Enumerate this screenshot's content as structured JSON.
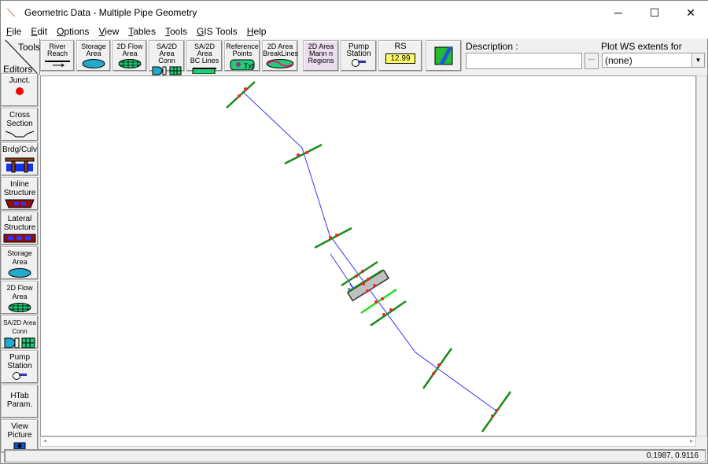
{
  "window": {
    "title": "Geometric Data - Multiple Pipe Geometry",
    "minimize": "─",
    "maximize": "☐",
    "close": "✕"
  },
  "menu": [
    "File",
    "Edit",
    "Options",
    "View",
    "Tables",
    "Tools",
    "GIS Tools",
    "Help"
  ],
  "tabs": {
    "tools": "Tools",
    "editors": "Editors"
  },
  "toolbar": [
    {
      "l1": "River",
      "l2": "Reach"
    },
    {
      "l1": "Storage",
      "l2": "Area"
    },
    {
      "l1": "2D Flow",
      "l2": "Area"
    },
    {
      "l1": "SA/2D Area",
      "l2": "Conn"
    },
    {
      "l1": "SA/2D Area",
      "l2": "BC Lines"
    },
    {
      "l1": "Reference",
      "l2": "Points"
    },
    {
      "l1": "2D Area",
      "l2": "BreakLines"
    },
    {
      "l1": "2D Area",
      "l2": "Mann n",
      "l3": "Regions"
    },
    {
      "l1": "Pump",
      "l2": "Station"
    },
    {
      "l1": "RS",
      "l2": "12.99"
    }
  ],
  "description": {
    "label": "Description :",
    "value": "",
    "button": "..."
  },
  "plot_profile": {
    "label": "Plot WS extents for Profile:",
    "selected": "(none)"
  },
  "editors": [
    {
      "l1": "Junct.",
      "l2": ""
    },
    {
      "l1": "Cross",
      "l2": "Section"
    },
    {
      "l1": "Brdg/Culv",
      "l2": ""
    },
    {
      "l1": "Inline",
      "l2": "Structure"
    },
    {
      "l1": "Lateral",
      "l2": "Structure"
    },
    {
      "l1": "Storage",
      "l2": "Area"
    },
    {
      "l1": "2D Flow",
      "l2": "Area"
    },
    {
      "l1": "SA/2D Area",
      "l2": "Conn"
    },
    {
      "l1": "Pump",
      "l2": "Station"
    },
    {
      "l1": "HTab",
      "l2": "Param."
    },
    {
      "l1": "View",
      "l2": "Picture"
    }
  ],
  "status": {
    "coords": "0.1987, 0.9116"
  },
  "colors": {
    "reach": "#3333ff",
    "xs": "#1a8a1a",
    "xs_selected": "#22dd22",
    "node": "#ff2020",
    "culvert": "#c0c0c0"
  }
}
